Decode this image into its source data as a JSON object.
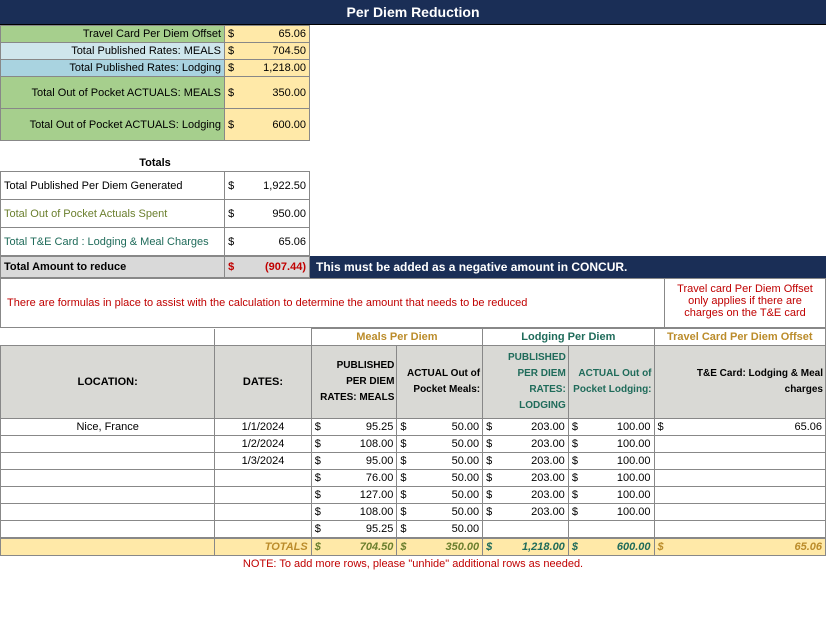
{
  "title": "Per Diem Reduction",
  "summary": {
    "travel_card_offset": {
      "label": "Travel Card Per Diem Offset",
      "value": "65.06"
    },
    "pub_meals": {
      "label": "Total Published Rates: MEALS",
      "value": "704.50"
    },
    "pub_lodging": {
      "label": "Total Published Rates: Lodging",
      "value": "1,218.00"
    },
    "oop_meals": {
      "label": "Total Out of Pocket ACTUALS: MEALS",
      "value": "350.00"
    },
    "oop_lodging": {
      "label": "Total Out of Pocket ACTUALS: Lodging",
      "value": "600.00"
    }
  },
  "totals_header": "Totals",
  "totals": {
    "pub_generated": {
      "label": "Total Published Per Diem Generated",
      "value": "1,922.50"
    },
    "oop_spent": {
      "label": "Total Out of Pocket Actuals Spent",
      "value": "950.00"
    },
    "te_charges": {
      "label": "Total T&E Card : Lodging & Meal Charges",
      "value": "65.06"
    },
    "reduce": {
      "label": "Total Amount to reduce",
      "value": "(907.44)"
    }
  },
  "concur_note": "This must be added as a negative amount in CONCUR.",
  "formula_note": "There are formulas in place to assist with the calculation to determine the amount that needs to be reduced",
  "offset_note": "Travel card Per Diem Offset only applies if there are charges on the T&E card",
  "headers": {
    "location": "LOCATION:",
    "dates": "DATES:",
    "meals_group": "Meals Per Diem",
    "lodging_group": "Lodging Per Diem",
    "offset_group": "Travel Card Per Diem Offset",
    "pub_meals": "PUBLISHED PER DIEM RATES: MEALS",
    "act_meals": "ACTUAL Out of Pocket Meals:",
    "pub_lodg": "PUBLISHED PER DIEM RATES: LODGING",
    "act_lodg": "ACTUAL Out of Pocket Lodging:",
    "te_card": "T&E Card: Lodging & Meal charges"
  },
  "rows": [
    {
      "location": "Nice, France",
      "date": "1/1/2024",
      "pub_meals": "95.25",
      "act_meals": "50.00",
      "pub_lodg": "203.00",
      "act_lodg": "100.00",
      "te": "65.06"
    },
    {
      "location": "",
      "date": "1/2/2024",
      "pub_meals": "108.00",
      "act_meals": "50.00",
      "pub_lodg": "203.00",
      "act_lodg": "100.00",
      "te": ""
    },
    {
      "location": "",
      "date": "1/3/2024",
      "pub_meals": "95.00",
      "act_meals": "50.00",
      "pub_lodg": "203.00",
      "act_lodg": "100.00",
      "te": ""
    },
    {
      "location": "",
      "date": "",
      "pub_meals": "76.00",
      "act_meals": "50.00",
      "pub_lodg": "203.00",
      "act_lodg": "100.00",
      "te": ""
    },
    {
      "location": "",
      "date": "",
      "pub_meals": "127.00",
      "act_meals": "50.00",
      "pub_lodg": "203.00",
      "act_lodg": "100.00",
      "te": ""
    },
    {
      "location": "",
      "date": "",
      "pub_meals": "108.00",
      "act_meals": "50.00",
      "pub_lodg": "203.00",
      "act_lodg": "100.00",
      "te": ""
    },
    {
      "location": "",
      "date": "",
      "pub_meals": "95.25",
      "act_meals": "50.00",
      "pub_lodg": "",
      "act_lodg": "",
      "te": ""
    },
    {
      "location": "",
      "date": "",
      "pub_meals": "",
      "act_meals": "",
      "pub_lodg": "",
      "act_lodg": "",
      "te": ""
    }
  ],
  "row_totals": {
    "label": "TOTALS",
    "pub_meals": "704.50",
    "act_meals": "350.00",
    "pub_lodg": "1,218.00",
    "act_lodg": "600.00",
    "te": "65.06"
  },
  "unhide_note": "NOTE: To add more rows, please \"unhide\" additional rows as needed.",
  "dollar": "$"
}
